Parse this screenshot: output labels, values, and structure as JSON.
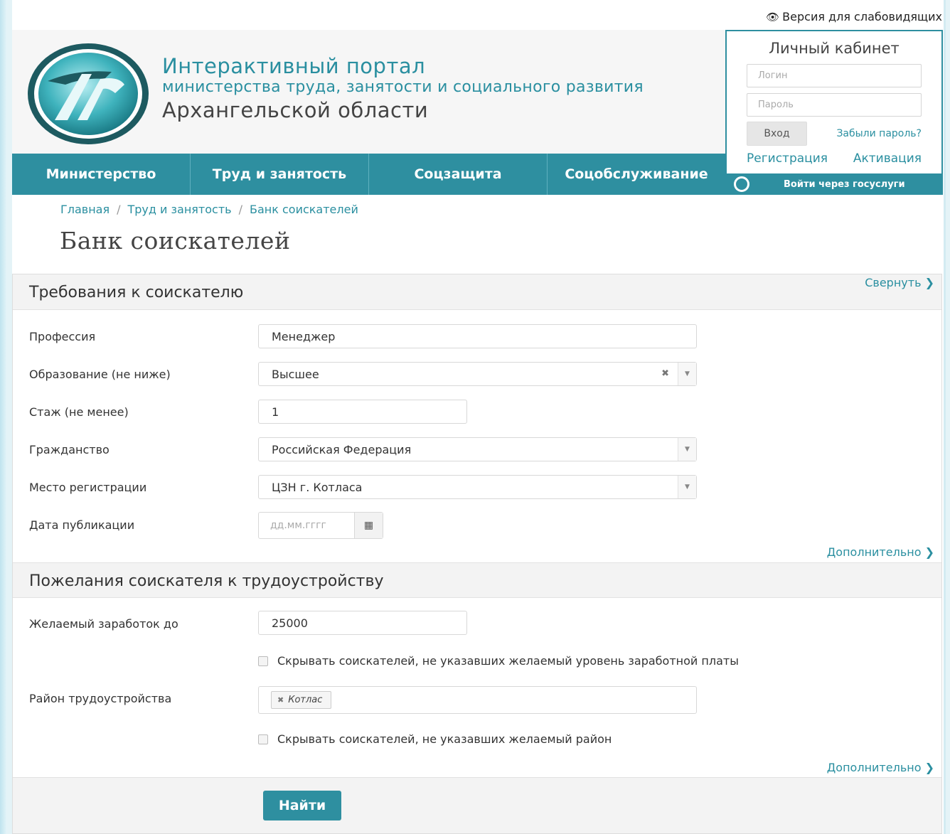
{
  "accessibility": {
    "label": "Версия для слабовидящих",
    "icon": "eye-icon"
  },
  "header": {
    "line1": "Интерактивный портал",
    "line2": "министерства труда, занятости и социального развития",
    "line3": "Архангельской области"
  },
  "nav": {
    "items": [
      {
        "label": "Министерство"
      },
      {
        "label": "Труд и занятость"
      },
      {
        "label": "Соцзащита"
      },
      {
        "label": "Соцобслуживание"
      }
    ]
  },
  "cabinet": {
    "title": "Личный кабинет",
    "login_placeholder": "Логин",
    "password_placeholder": "Пароль",
    "login_button": "Вход",
    "forgot": "Забыли пароль?",
    "register": "Регистрация",
    "activate": "Активация",
    "gosuslugi": "Войти через госуслуги"
  },
  "breadcrumb": [
    {
      "label": "Главная"
    },
    {
      "label": "Труд и занятость"
    },
    {
      "label": "Банк соискателей"
    }
  ],
  "page_title": "Банк соискателей",
  "requirements": {
    "title": "Требования к соискателю",
    "collapse": "Свернуть",
    "more": "Дополнительно",
    "profession": {
      "label": "Профессия",
      "value": "Менеджер"
    },
    "education": {
      "label": "Образование (не ниже)",
      "value": "Высшее"
    },
    "experience": {
      "label": "Стаж (не менее)",
      "value": "1"
    },
    "citizenship": {
      "label": "Гражданство",
      "value": "Российская Федерация"
    },
    "registration": {
      "label": "Место регистрации",
      "value": "ЦЗН г. Котласа"
    },
    "pub_date": {
      "label": "Дата публикации",
      "placeholder": "дд.мм.гггг"
    }
  },
  "wishes": {
    "title": "Пожелания соискателя к трудоустройству",
    "more": "Дополнительно",
    "salary": {
      "label": "Желаемый заработок до",
      "value": "25000"
    },
    "hide_no_salary": "Скрывать соискателей, не указавших желаемый уровень заработной платы",
    "district": {
      "label": "Район трудоустройства",
      "tag": "Котлас"
    },
    "hide_no_district": "Скрывать соискателей, не указавших желаемый район"
  },
  "find_button": "Найти",
  "colors": {
    "accent": "#2e8fa0",
    "link": "#2a8fa0"
  }
}
